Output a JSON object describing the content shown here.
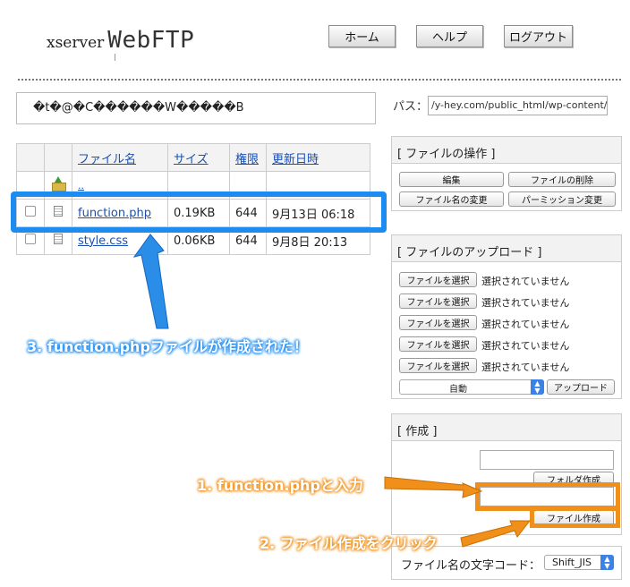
{
  "logo": {
    "small": "xserver",
    "big": "WebFTP"
  },
  "nav": {
    "home": "ホーム",
    "help": "ヘルプ",
    "logout": "ログアウト"
  },
  "message": "�t�@�C������W�����B",
  "path": {
    "label": "パス：",
    "value": "/y-hey.com/public_html/wp-content/t"
  },
  "table": {
    "headers": {
      "name": "ファイル名",
      "size": "サイズ",
      "perm": "権限",
      "date": "更新日時"
    },
    "parent": "..",
    "rows": [
      {
        "name": "function.php",
        "size": "0.19KB",
        "perm": "644",
        "date": "9月13日 06:18"
      },
      {
        "name": "style.css",
        "size": "0.06KB",
        "perm": "644",
        "date": "9月8日 20:13"
      }
    ]
  },
  "ops": {
    "title": "[ ファイルの操作 ]",
    "edit": "編集",
    "delete": "ファイルの削除",
    "rename": "ファイル名の変更",
    "chmod": "パーミッション変更"
  },
  "upload": {
    "title": "[ ファイルのアップロード ]",
    "choose": "ファイルを選択",
    "none": "選択されていません",
    "mode": "自動",
    "submit": "アップロード"
  },
  "create": {
    "title": "[ 作成 ]",
    "folder_button": "フォルダ作成",
    "file_button": "ファイル作成"
  },
  "encoding": {
    "label": "ファイル名の文字コード：",
    "value": "Shift_JIS"
  },
  "annotations": {
    "step1": "1. function.phpと入力",
    "step2": "2. ファイル作成をクリック",
    "step3": "3. function.phpファイルが作成された！"
  },
  "colors": {
    "highlight_blue": "#1d8cf0",
    "highlight_orange": "#f0901a",
    "link": "#1a4fb0"
  }
}
